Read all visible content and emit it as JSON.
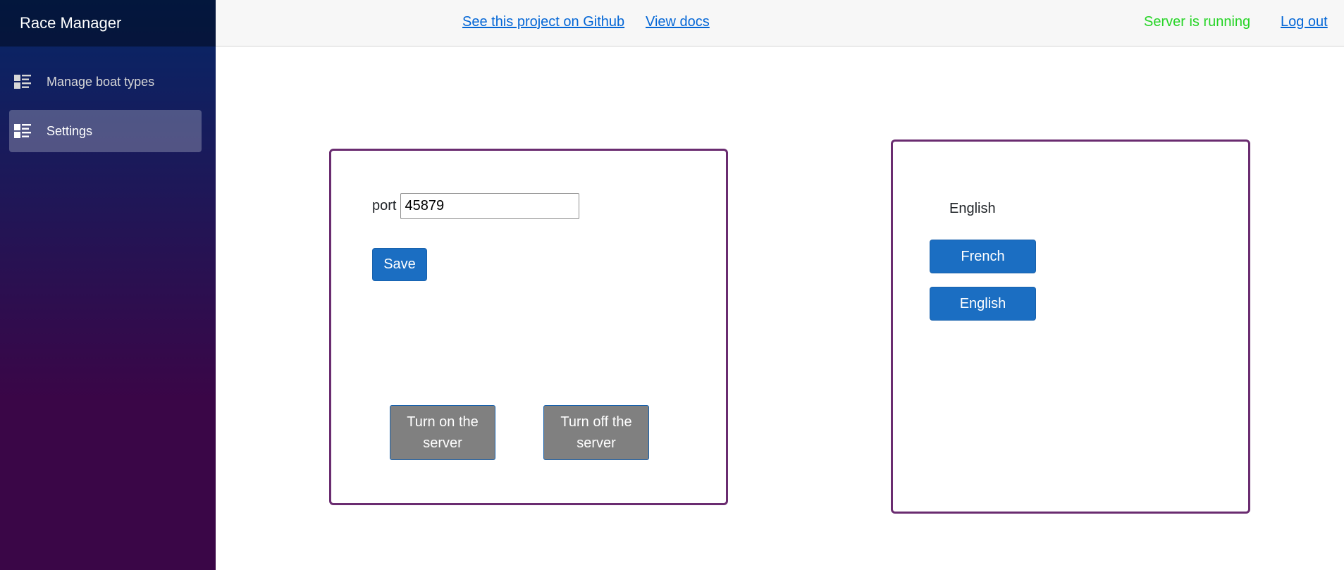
{
  "app": {
    "title": "Race Manager"
  },
  "sidebar": {
    "items": [
      {
        "label": "Manage boat types",
        "icon": "list-icon",
        "active": false
      },
      {
        "label": "Settings",
        "icon": "list-icon",
        "active": true
      }
    ]
  },
  "topbar": {
    "github_link": "See this project on Github",
    "docs_link": "View docs",
    "server_status": "Server is running",
    "logout_link": "Log out"
  },
  "server_settings": {
    "port_label": "port",
    "port_value": "45879",
    "save_label": "Save",
    "turn_on_label": "Turn on the server",
    "turn_off_label": "Turn off the server"
  },
  "language": {
    "current": "English",
    "options": [
      "French",
      "English"
    ]
  },
  "colors": {
    "accent": "#1b6ec2",
    "card_border": "#6a2c70",
    "status_ok": "#26d426",
    "server_button": "#808080",
    "sidebar_gradient_top": "#052767",
    "sidebar_gradient_bottom": "#3a0647"
  }
}
